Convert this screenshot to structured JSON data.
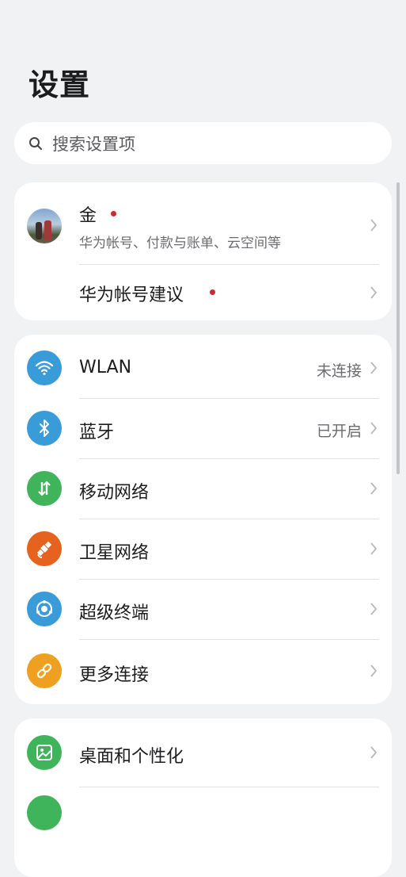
{
  "page": {
    "title": "设置"
  },
  "search": {
    "placeholder": "搜索设置项"
  },
  "account": {
    "name": "金",
    "subtitle": "华为帐号、付款与账单、云空间等",
    "suggestion_label": "华为帐号建议"
  },
  "connections": {
    "items": [
      {
        "label": "WLAN",
        "value": "未连接",
        "icon": "wifi-icon",
        "color": "#3a9bd9"
      },
      {
        "label": "蓝牙",
        "value": "已开启",
        "icon": "bluetooth-icon",
        "color": "#3a9bd9"
      },
      {
        "label": "移动网络",
        "value": "",
        "icon": "mobile-network-icon",
        "color": "#3fb45a"
      },
      {
        "label": "卫星网络",
        "value": "",
        "icon": "satellite-icon",
        "color": "#e6621f"
      },
      {
        "label": "超级终端",
        "value": "",
        "icon": "super-device-icon",
        "color": "#3a9bd9"
      },
      {
        "label": "更多连接",
        "value": "",
        "icon": "link-icon",
        "color": "#f0a020"
      }
    ]
  },
  "display": {
    "items": [
      {
        "label": "桌面和个性化",
        "icon": "wallpaper-icon",
        "color": "#3fb45a"
      }
    ]
  },
  "colors": {
    "notification_dot": "#d0282e",
    "background": "#f1f2f4"
  }
}
